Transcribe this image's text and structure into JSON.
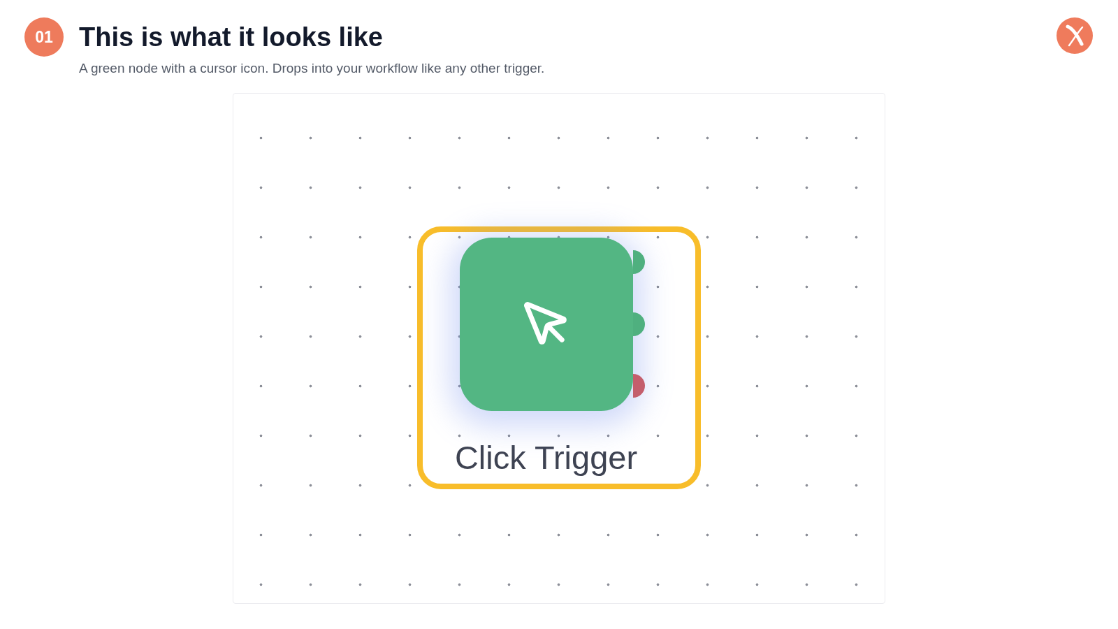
{
  "header": {
    "step": "01",
    "title": "This is what it looks like",
    "subtitle": "A green node with a cursor icon. Drops into your workflow like any other trigger."
  },
  "canvas": {
    "node": {
      "label": "Click Trigger",
      "highlighted": true,
      "ports": [
        {
          "color": "#4fb07f"
        },
        {
          "color": "#4fb07f"
        },
        {
          "color": "#c45e6c"
        }
      ]
    }
  }
}
